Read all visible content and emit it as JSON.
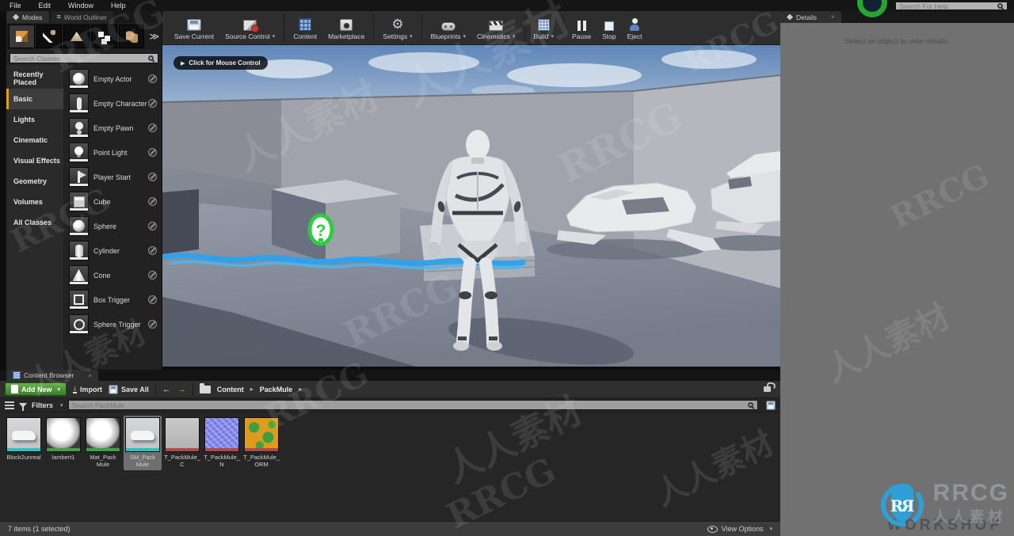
{
  "menu_bar": {
    "items": [
      "File",
      "Edit",
      "Window",
      "Help"
    ],
    "help_search_placeholder": "Search For Help"
  },
  "modes_panel": {
    "tabs": [
      "Modes",
      "World Outliner"
    ],
    "search_placeholder": "Search Classes",
    "categories": [
      "Recently Placed",
      "Basic",
      "Lights",
      "Cinematic",
      "Visual Effects",
      "Geometry",
      "Volumes",
      "All Classes"
    ],
    "selected_category": "Basic",
    "items": [
      "Empty Actor",
      "Empty Character",
      "Empty Pawn",
      "Point Light",
      "Player Start",
      "Cube",
      "Sphere",
      "Cylinder",
      "Cone",
      "Box Trigger",
      "Sphere Trigger"
    ]
  },
  "toolbar": {
    "buttons": [
      {
        "label": "Save Current",
        "dropdown": false
      },
      {
        "label": "Source Control",
        "dropdown": true
      },
      {
        "label": "Content",
        "dropdown": false
      },
      {
        "label": "Marketplace",
        "dropdown": false
      },
      {
        "label": "Settings",
        "dropdown": true
      },
      {
        "label": "Blueprints",
        "dropdown": true
      },
      {
        "label": "Cinematics",
        "dropdown": true
      },
      {
        "label": "Build",
        "dropdown": true
      },
      {
        "label": "Pause",
        "dropdown": false
      },
      {
        "label": "Stop",
        "dropdown": false
      },
      {
        "label": "Eject",
        "dropdown": false
      }
    ]
  },
  "viewport": {
    "mouse_control_label": "Click for Mouse Control",
    "pickup_glyph": "?"
  },
  "details_panel": {
    "tab_label": "Details",
    "empty_message": "Select an object to view details."
  },
  "content_browser": {
    "tab_label": "Content Browser",
    "add_new_label": "Add New",
    "import_label": "Import",
    "save_all_label": "Save All",
    "breadcrumbs": [
      "Content",
      "PackMule"
    ],
    "filters_label": "Filters",
    "search_placeholder": "Search PackMule",
    "assets": [
      {
        "name": "Block2unreal",
        "type": "static-mesh",
        "stripe": "#2fc1bc",
        "selected": false
      },
      {
        "name": "lambert1",
        "type": "material",
        "stripe": "#43a047",
        "selected": false
      },
      {
        "name": "Mat_Pack Mule",
        "type": "material",
        "stripe": "#43a047",
        "selected": false
      },
      {
        "name": "SM_Pack Mule",
        "type": "static-mesh",
        "stripe": "#2fc1bc",
        "selected": true
      },
      {
        "name": "T_PackMule_C",
        "type": "texture",
        "stripe": "#b04a4a",
        "selected": false
      },
      {
        "name": "T_PackMule_N",
        "type": "texture",
        "stripe": "#b04a4a",
        "selected": false
      },
      {
        "name": "T_PackMule_ORM",
        "type": "texture",
        "stripe": "#b04a4a",
        "selected": false
      }
    ],
    "status_text": "7 items (1 selected)",
    "view_options_label": "View Options"
  },
  "watermark": {
    "cn": "人人素材",
    "en": "RRCG"
  },
  "logo": {
    "title": "RRCG",
    "subtitle": "人人素材",
    "shadow_text": "WORKSHOP"
  },
  "colors": {
    "add_new_green": "#4a9e3f",
    "stripe_mesh": "#2fc1bc",
    "stripe_material": "#43a047",
    "stripe_texture": "#b04a4a",
    "pickup_green": "#2ecc40",
    "water_blue": "#2aa3ef",
    "logo_blue": "#2f9fd8"
  }
}
